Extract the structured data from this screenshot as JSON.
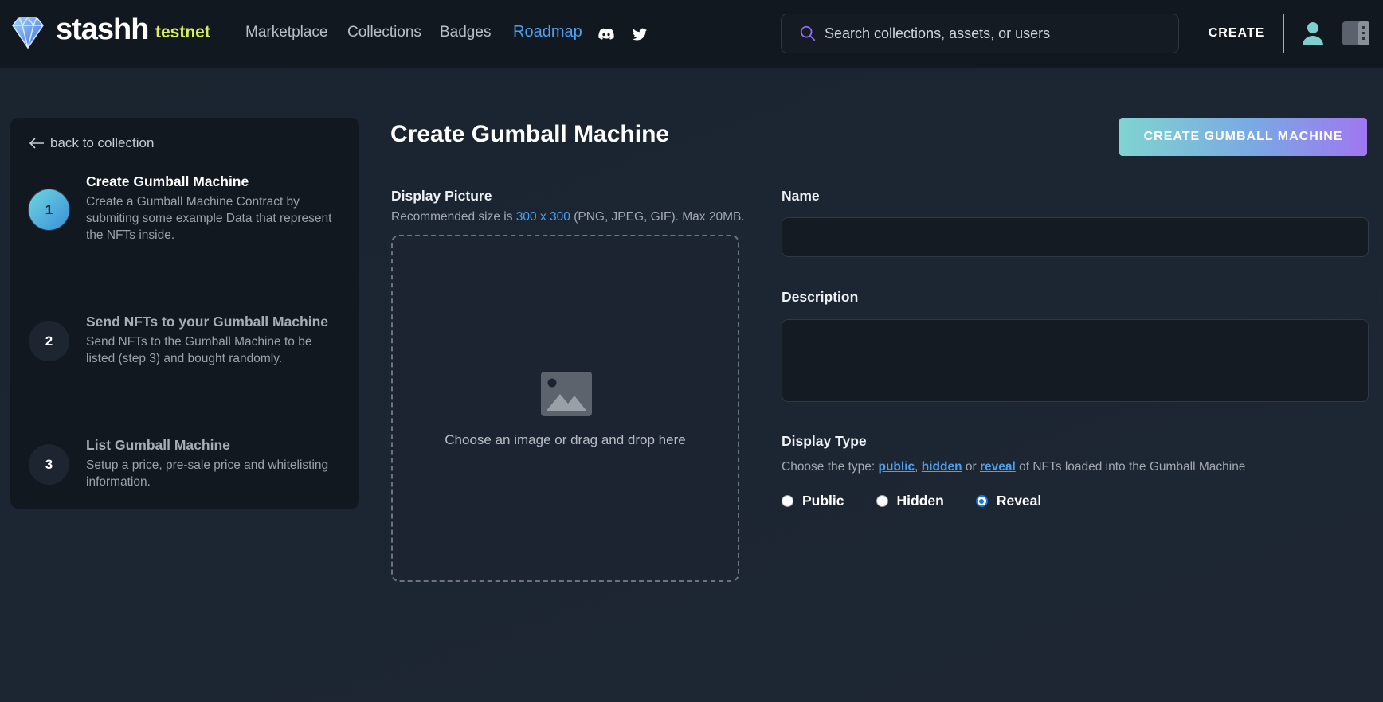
{
  "header": {
    "brand": "stashh",
    "network": "testnet",
    "nav": [
      "Marketplace",
      "Collections",
      "Badges",
      "Roadmap"
    ],
    "search_placeholder": "Search collections, assets, or users",
    "create_label": "CREATE",
    "icons": [
      "gem-logo-icon",
      "discord-icon",
      "twitter-icon",
      "search-icon",
      "user-icon",
      "side-panel-icon"
    ]
  },
  "sidebar": {
    "back_label": "back to collection",
    "steps": [
      {
        "number": "1",
        "title": "Create Gumball Machine",
        "description": "Create a Gumball Machine Contract by submiting some example Data that represent the NFTs inside.",
        "active": true
      },
      {
        "number": "2",
        "title": "Send NFTs to your Gumball Machine",
        "description": "Send NFTs to the Gumball Machine to be listed (step 3) and bought randomly.",
        "active": false
      },
      {
        "number": "3",
        "title": "List Gumball Machine",
        "description": "Setup a price, pre-sale price and whitelisting information.",
        "active": false
      }
    ]
  },
  "main": {
    "title": "Create Gumball Machine",
    "primary_button": "CREATE GUMBALL MACHINE",
    "display_picture": {
      "label": "Display Picture",
      "help_prefix": "Recommended size is ",
      "help_size": "300 x 300",
      "help_suffix": " (PNG, JPEG, GIF). Max 20MB.",
      "drop_text": "Choose an image or drag and drop here"
    },
    "name": {
      "label": "Name",
      "value": "",
      "placeholder": ""
    },
    "description": {
      "label": "Description",
      "value": "",
      "placeholder": ""
    },
    "display_type": {
      "label": "Display Type",
      "help_prefix": "Choose the type: ",
      "link_public": "public",
      "sep1": ", ",
      "link_hidden": "hidden",
      "sep2": " or ",
      "link_reveal": "reveal",
      "help_suffix": " of NFTs loaded into the Gumball Machine",
      "options": [
        "Public",
        "Hidden",
        "Reveal"
      ],
      "selected": "Reveal"
    }
  },
  "colors": {
    "accent_blue": "#4d9ff0",
    "network_yellow": "#d7ef5a",
    "gradient_start": "#7fd4d0",
    "gradient_end": "#a077f0"
  }
}
